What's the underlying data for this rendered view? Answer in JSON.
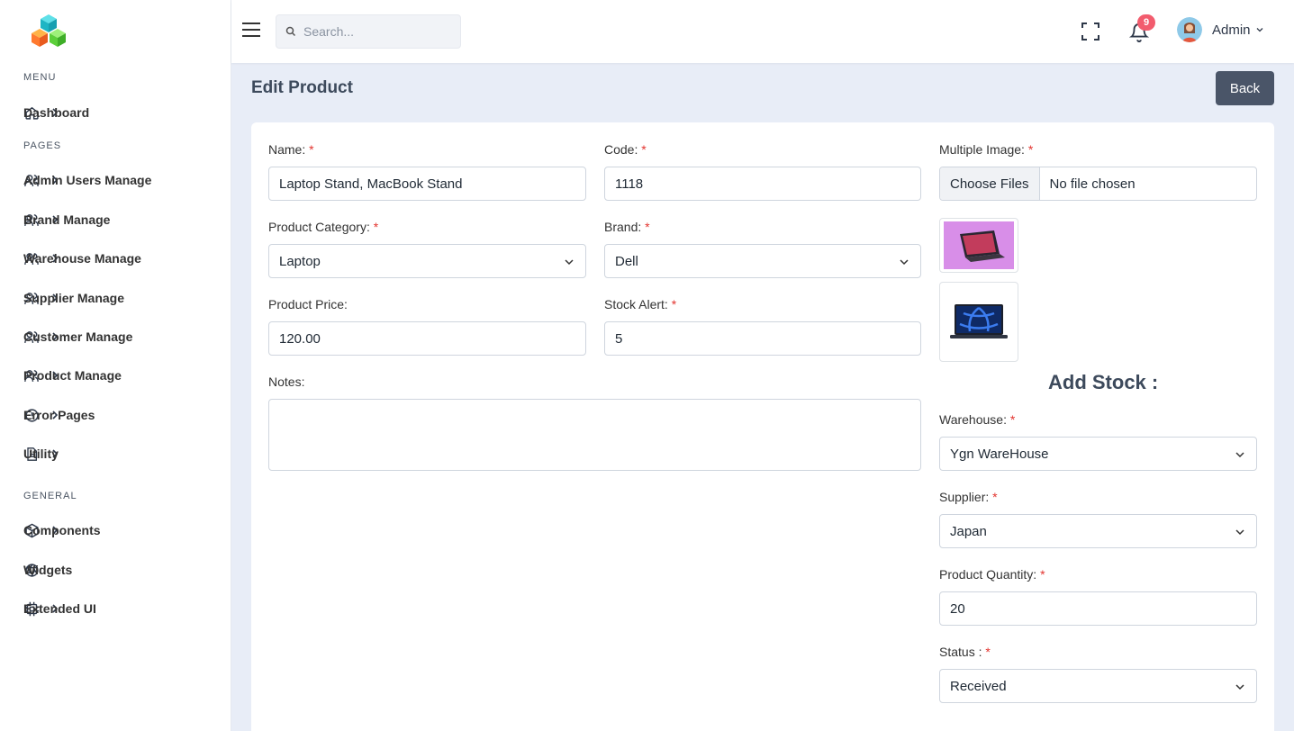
{
  "sidebar": {
    "sections": {
      "menu": "MENU",
      "pages": "PAGES",
      "general": "GENERAL"
    },
    "items": {
      "dashboard": "Dashboard",
      "admin_users": "Admin Users Manage",
      "brand": "Brand Manage",
      "warehouse": "Warehouse Manage",
      "supplier": "Supplier Manage",
      "customer": "Customer Manage",
      "product": "Product Manage",
      "error_pages": "Error Pages",
      "utility": "Utility",
      "components": "Components",
      "widgets": "Widgets",
      "extended_ui": "Extended UI"
    }
  },
  "topbar": {
    "search_placeholder": "Search...",
    "notification_count": "9",
    "user_name": "Admin"
  },
  "page": {
    "title": "Edit Product",
    "back_label": "Back"
  },
  "form": {
    "name_label": "Name:",
    "name_value": "Laptop Stand, MacBook Stand",
    "code_label": "Code:",
    "code_value": "1118",
    "images_label": "Multiple Image:",
    "choose_files": "Choose Files",
    "no_file": "No file chosen",
    "category_label": "Product Category:",
    "category_value": "Laptop",
    "brand_label": "Brand:",
    "brand_value": "Dell",
    "price_label": "Product Price:",
    "price_value": "120.00",
    "stock_alert_label": "Stock Alert:",
    "stock_alert_value": "5",
    "notes_label": "Notes:",
    "required_mark": "*"
  },
  "stock": {
    "heading": "Add Stock :",
    "warehouse_label": "Warehouse:",
    "warehouse_value": "Ygn WareHouse",
    "supplier_label": "Supplier:",
    "supplier_value": "Japan",
    "quantity_label": "Product Quantity:",
    "quantity_value": "20",
    "status_label": "Status :",
    "status_value": "Received"
  },
  "colors": {
    "accent": "#4a5568",
    "required": "#e3342f",
    "badge": "#f25c6e",
    "background": "#e8edf7"
  }
}
